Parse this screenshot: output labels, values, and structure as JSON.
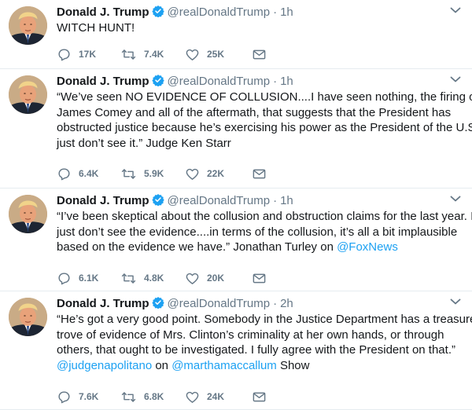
{
  "tweets": [
    {
      "name": "Donald J. Trump",
      "handle": "@realDonaldTrump",
      "separator": "·",
      "time": "1h",
      "lines": [
        {
          "parts": [
            {
              "t": "WITCH HUNT!"
            }
          ]
        }
      ],
      "replies": "17K",
      "retweets": "7.4K",
      "likes": "25K"
    },
    {
      "name": "Donald J. Trump",
      "handle": "@realDonaldTrump",
      "separator": "·",
      "time": "1h",
      "lines": [
        {
          "parts": [
            {
              "t": "“We’ve seen NO EVIDENCE OF COLLUSION....I have seen nothing, the firing of"
            }
          ]
        },
        {
          "parts": [
            {
              "t": "James Comey and all of the aftermath, that suggests that the President has"
            }
          ]
        },
        {
          "parts": [
            {
              "t": "obstructed justice because he’s exercising his power as the President of the U.S. I"
            }
          ]
        },
        {
          "parts": [
            {
              "t": "just don’t see it.”  Judge Ken Starr"
            }
          ]
        }
      ],
      "replies": "6.4K",
      "retweets": "5.9K",
      "likes": "22K"
    },
    {
      "name": "Donald J. Trump",
      "handle": "@realDonaldTrump",
      "separator": "·",
      "time": "1h",
      "lines": [
        {
          "parts": [
            {
              "t": "“I’ve been skeptical about the collusion and obstruction claims for the last year. I"
            }
          ]
        },
        {
          "parts": [
            {
              "t": "just don’t see the evidence....in terms of the collusion, it’s all a bit implausible"
            }
          ]
        },
        {
          "parts": [
            {
              "t": "based on the evidence we have.”  Jonathan Turley on "
            },
            {
              "t": "@FoxNews",
              "link": true
            }
          ]
        }
      ],
      "replies": "6.1K",
      "retweets": "4.8K",
      "likes": "20K"
    },
    {
      "name": "Donald J. Trump",
      "handle": "@realDonaldTrump",
      "separator": "·",
      "time": "2h",
      "lines": [
        {
          "parts": [
            {
              "t": "“He’s got a very good point. Somebody in the Justice Department has a treasure"
            }
          ]
        },
        {
          "parts": [
            {
              "t": "trove of evidence of Mrs. Clinton’s criminality at her own hands, or through"
            }
          ]
        },
        {
          "parts": [
            {
              "t": "others, that ought to be investigated. I fully agree with the President on that.”"
            }
          ]
        },
        {
          "parts": [
            {
              "t": "@judgenapolitano",
              "link": true
            },
            {
              "t": " on "
            },
            {
              "t": "@marthamaccallum",
              "link": true
            },
            {
              "t": " Show"
            }
          ]
        }
      ],
      "replies": "7.6K",
      "retweets": "6.8K",
      "likes": "24K"
    }
  ],
  "icons": {
    "reply": "reply-icon",
    "retweet": "retweet-icon",
    "like": "heart-icon",
    "message": "envelope-icon",
    "verified": "verified-badge-icon",
    "caret": "chevron-down-icon"
  },
  "colors": {
    "text": "#14171a",
    "secondary": "#657786",
    "link": "#1da1f2",
    "verified": "#1da1f2",
    "divider": "#e6ecf0"
  }
}
